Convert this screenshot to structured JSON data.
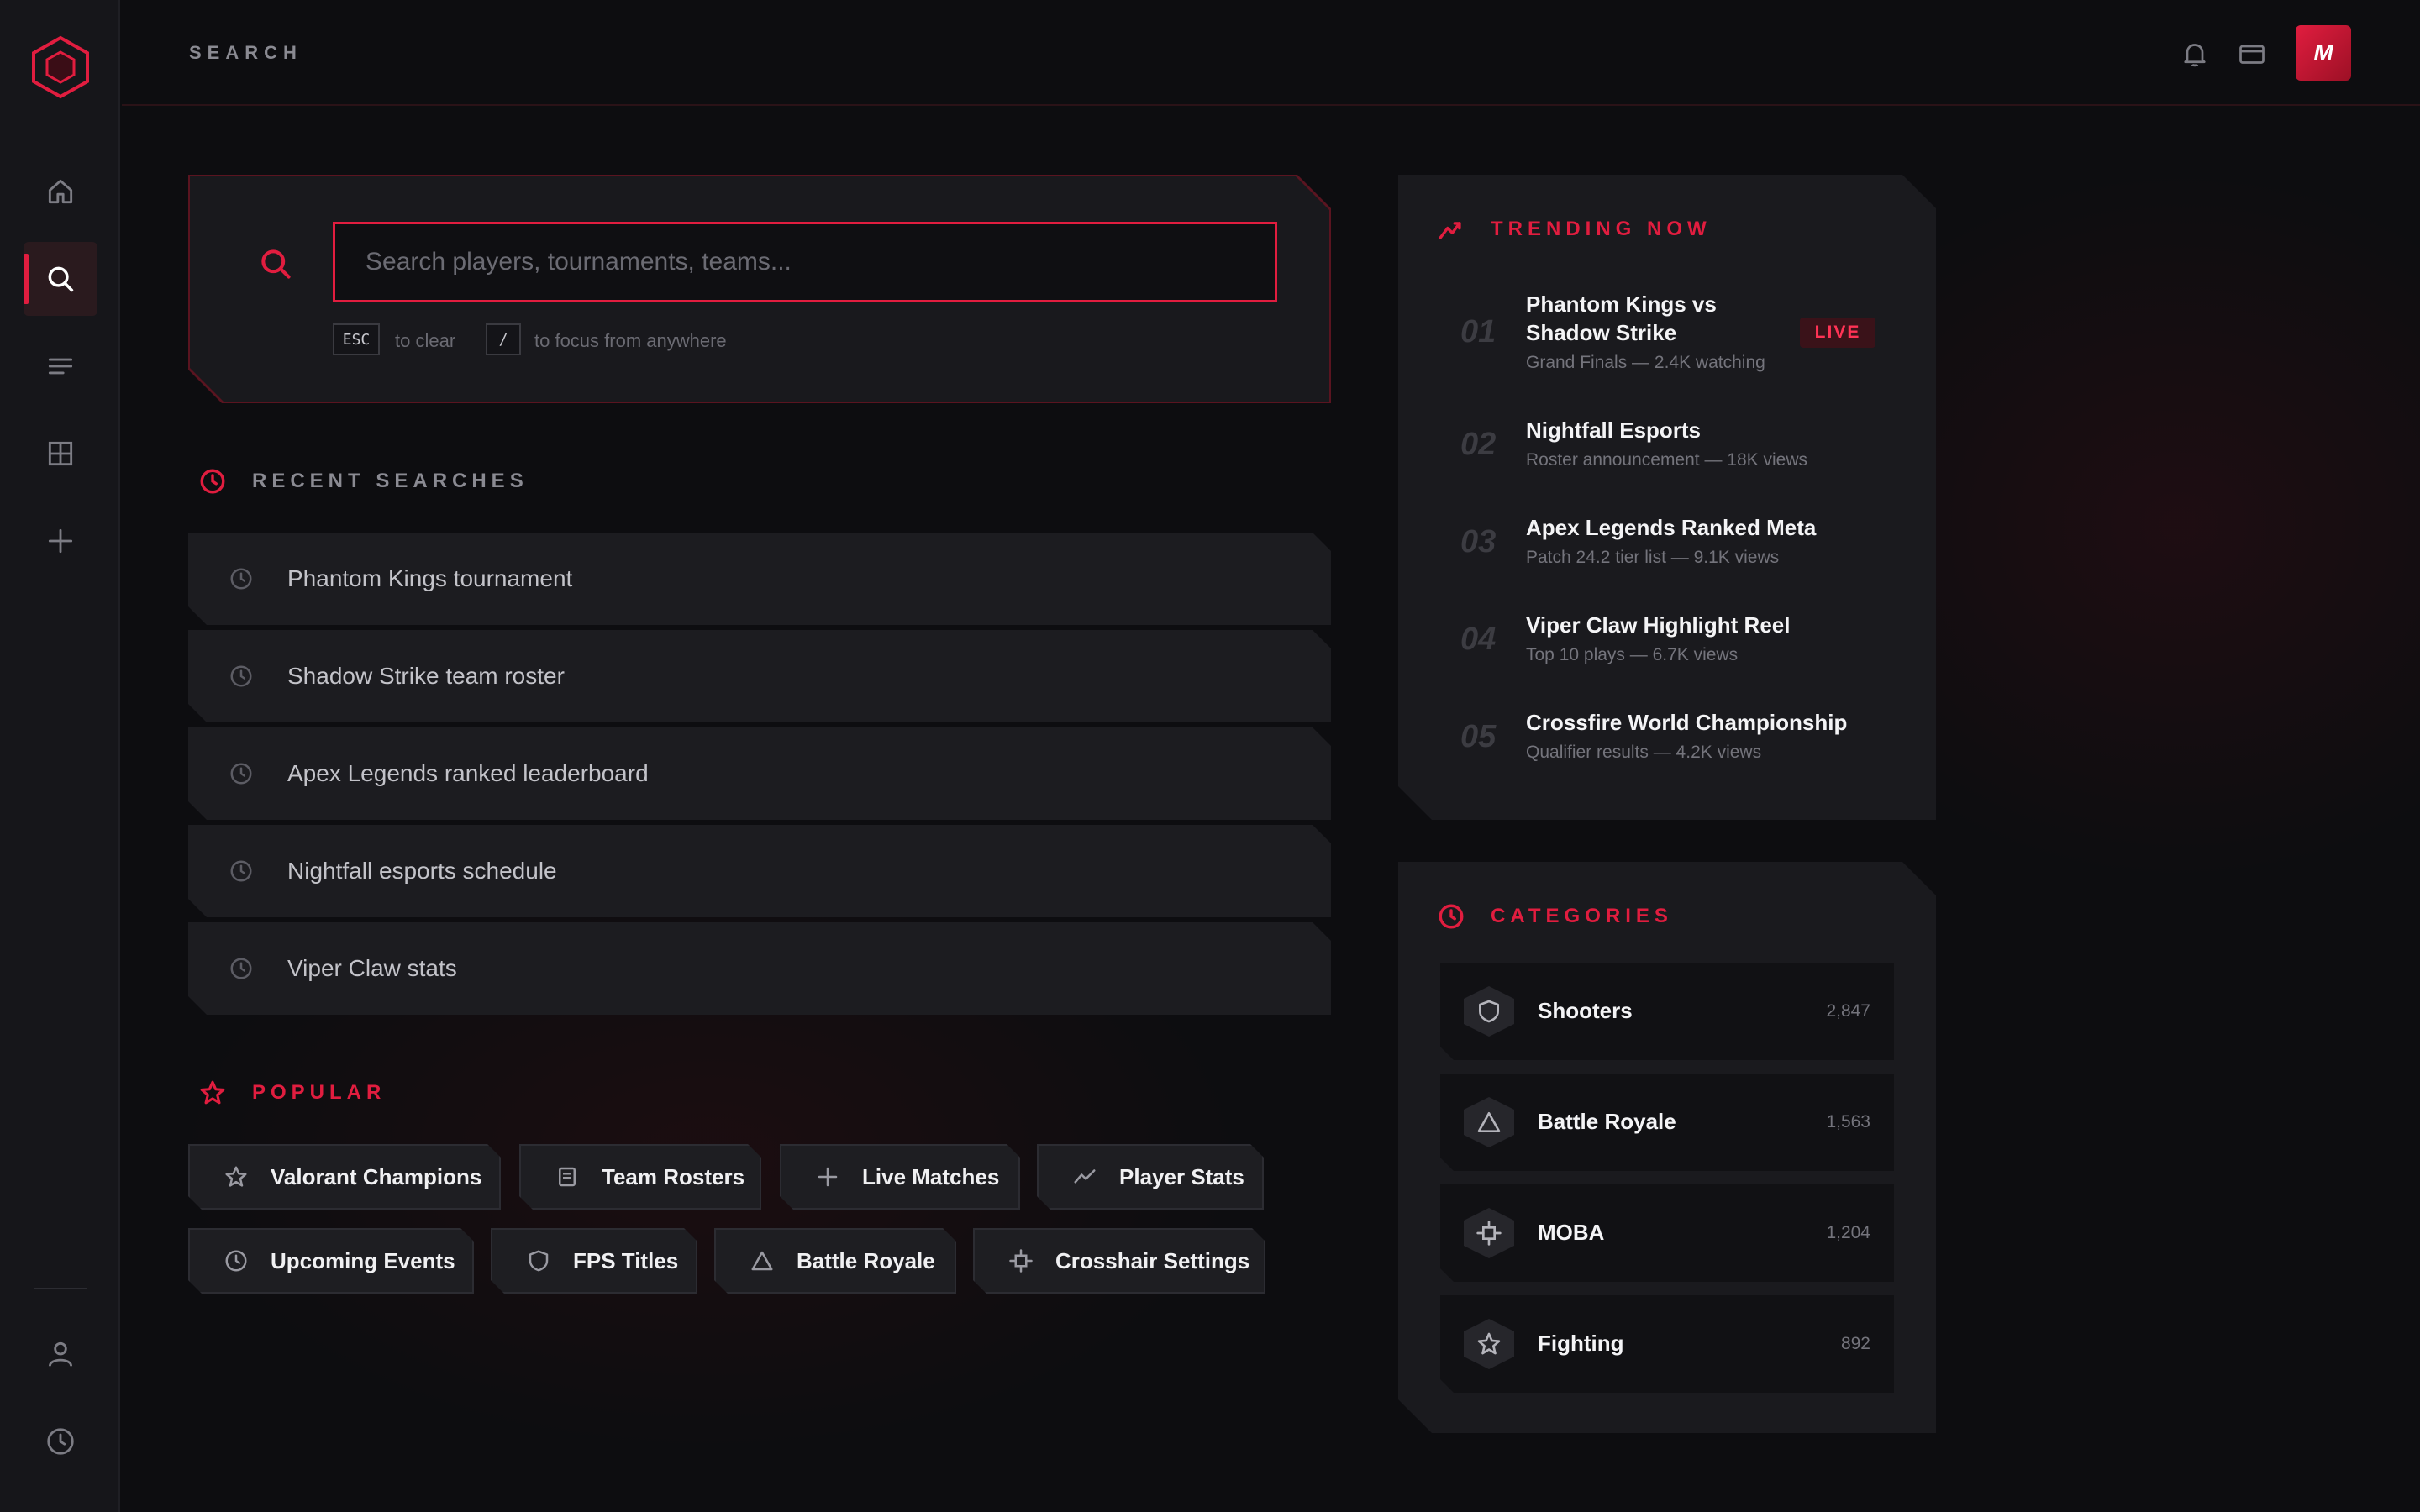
{
  "header": {
    "title": "SEARCH",
    "avatar_initial": "M"
  },
  "colors": {
    "accent": "#e11d3f",
    "background": "#0d0d10",
    "panel": "#1a1a1e"
  },
  "sidebar": {
    "items": [
      {
        "icon": "home-icon"
      },
      {
        "icon": "search-icon",
        "active": true
      },
      {
        "icon": "list-icon"
      },
      {
        "icon": "grid-icon"
      },
      {
        "icon": "plus-icon"
      },
      {
        "icon": "user-icon"
      },
      {
        "icon": "clock-icon"
      }
    ]
  },
  "search": {
    "placeholder": "Search players, tournaments, teams...",
    "value": "",
    "hints": [
      {
        "key": "ESC",
        "text": "to clear"
      },
      {
        "key": "/",
        "text": "to focus from anywhere"
      }
    ]
  },
  "recent": {
    "title": "RECENT SEARCHES",
    "items": [
      "Phantom Kings tournament",
      "Shadow Strike team roster",
      "Apex Legends ranked leaderboard",
      "Nightfall esports schedule",
      "Viper Claw stats"
    ]
  },
  "popular": {
    "title": "POPULAR",
    "chips": [
      {
        "label": "Valorant Champions",
        "icon": "star-icon"
      },
      {
        "label": "Team Rosters",
        "icon": "document-icon"
      },
      {
        "label": "Live Matches",
        "icon": "plus-icon"
      },
      {
        "label": "Player Stats",
        "icon": "trend-icon"
      },
      {
        "label": "Upcoming Events",
        "icon": "clock-icon"
      },
      {
        "label": "FPS Titles",
        "icon": "shield-icon"
      },
      {
        "label": "Battle Royale",
        "icon": "triangle-icon"
      },
      {
        "label": "Crosshair Settings",
        "icon": "crosshair-icon"
      }
    ]
  },
  "trending": {
    "title": "TRENDING NOW",
    "live_label": "LIVE",
    "items": [
      {
        "num": "01",
        "title_line1": "Phantom Kings vs",
        "title_line2": "Shadow Strike",
        "sub": "Grand Finals — 2.4K watching",
        "live": true
      },
      {
        "num": "02",
        "title": "Nightfall Esports",
        "sub": "Roster announcement — 18K views"
      },
      {
        "num": "03",
        "title": "Apex Legends Ranked Meta",
        "sub": "Patch 24.2 tier list — 9.1K views"
      },
      {
        "num": "04",
        "title": "Viper Claw Highlight Reel",
        "sub": "Top 10 plays — 6.7K views"
      },
      {
        "num": "05",
        "title": "Crossfire World Championship",
        "sub": "Qualifier results — 4.2K views"
      }
    ]
  },
  "categories": {
    "title": "CATEGORIES",
    "items": [
      {
        "label": "Shooters",
        "count": "2,847",
        "icon": "shield-icon"
      },
      {
        "label": "Battle Royale",
        "count": "1,563",
        "icon": "triangle-icon"
      },
      {
        "label": "MOBA",
        "count": "1,204",
        "icon": "crosshair-icon"
      },
      {
        "label": "Fighting",
        "count": "892",
        "icon": "star-icon"
      }
    ]
  }
}
